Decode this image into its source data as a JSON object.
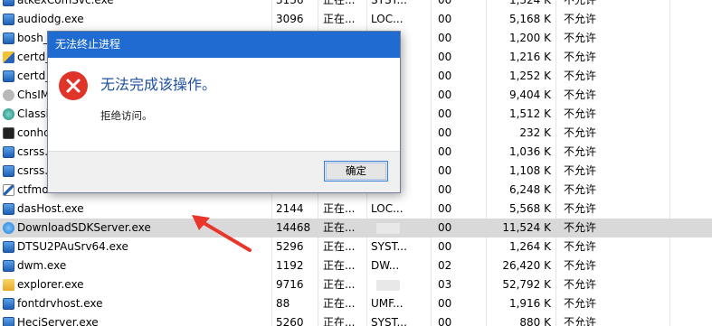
{
  "processes": [
    {
      "name": "atkexComSvc.exe",
      "pid": "3136",
      "status": "正在...",
      "user": "SYST...",
      "cpu": "00",
      "mem": "1,324 K",
      "virt": "不允许",
      "icon": "blue"
    },
    {
      "name": "audiodg.exe",
      "pid": "3096",
      "status": "正在...",
      "user": "LOC...",
      "cpu": "00",
      "mem": "5,168 K",
      "virt": "不允许",
      "icon": "blue"
    },
    {
      "name": "bosh_",
      "pid": "",
      "status": "",
      "user": "",
      "cpu": "00",
      "mem": "1,200 K",
      "virt": "不允许",
      "icon": "blue"
    },
    {
      "name": "certd_",
      "pid": "",
      "status": "",
      "user": "",
      "cpu": "00",
      "mem": "1,216 K",
      "virt": "不允许",
      "icon": "cert"
    },
    {
      "name": "certd_",
      "pid": "",
      "status": "",
      "user": "",
      "cpu": "00",
      "mem": "1,252 K",
      "virt": "不允许",
      "icon": "blue"
    },
    {
      "name": "ChsIM",
      "pid": "",
      "status": "",
      "user": "",
      "cpu": "00",
      "mem": "9,404 K",
      "virt": "不允许",
      "icon": "gear"
    },
    {
      "name": "Classi",
      "pid": "",
      "status": "",
      "user": "",
      "cpu": "00",
      "mem": "1,512 K",
      "virt": "不允许",
      "icon": "teal"
    },
    {
      "name": "conhc",
      "pid": "",
      "status": "",
      "user": "",
      "cpu": "00",
      "mem": "232 K",
      "virt": "不允许",
      "icon": "console"
    },
    {
      "name": "csrss.",
      "pid": "",
      "status": "",
      "user": "",
      "cpu": "00",
      "mem": "1,036 K",
      "virt": "不允许",
      "icon": "blue"
    },
    {
      "name": "csrss.",
      "pid": "",
      "status": "",
      "user": "",
      "cpu": "00",
      "mem": "1,108 K",
      "virt": "不允许",
      "icon": "blue"
    },
    {
      "name": "ctfmo",
      "pid": "",
      "status": "",
      "user": "",
      "cpu": "00",
      "mem": "6,248 K",
      "virt": "不允许",
      "icon": "pen"
    },
    {
      "name": "dasHost.exe",
      "pid": "2144",
      "status": "正在...",
      "user": "LOC...",
      "cpu": "00",
      "mem": "5,568 K",
      "virt": "不允许",
      "icon": "blue"
    },
    {
      "name": "DownloadSDKServer.exe",
      "pid": "14468",
      "status": "正在...",
      "user": "",
      "cpu": "00",
      "mem": "11,524 K",
      "virt": "不允许",
      "icon": "download",
      "selected": true
    },
    {
      "name": "DTSU2PAuSrv64.exe",
      "pid": "5296",
      "status": "正在...",
      "user": "SYST...",
      "cpu": "00",
      "mem": "1,264 K",
      "virt": "不允许",
      "icon": "blue"
    },
    {
      "name": "dwm.exe",
      "pid": "1192",
      "status": "正在...",
      "user": "DW...",
      "cpu": "02",
      "mem": "26,420 K",
      "virt": "不允许",
      "icon": "blue"
    },
    {
      "name": "explorer.exe",
      "pid": "9716",
      "status": "正在...",
      "user": "",
      "cpu": "03",
      "mem": "52,792 K",
      "virt": "不允许",
      "icon": "folder"
    },
    {
      "name": "fontdrvhost.exe",
      "pid": "88",
      "status": "正在...",
      "user": "UMF...",
      "cpu": "00",
      "mem": "1,916 K",
      "virt": "不允许",
      "icon": "blue"
    },
    {
      "name": "HeciServer.exe",
      "pid": "5260",
      "status": "正在...",
      "user": "SYST...",
      "cpu": "00",
      "mem": "880 K",
      "virt": "不允许",
      "icon": "blue"
    }
  ],
  "dialog": {
    "title": "无法终止进程",
    "message": "无法完成该操作。",
    "detail": "拒绝访问。",
    "ok_label": "确定"
  }
}
